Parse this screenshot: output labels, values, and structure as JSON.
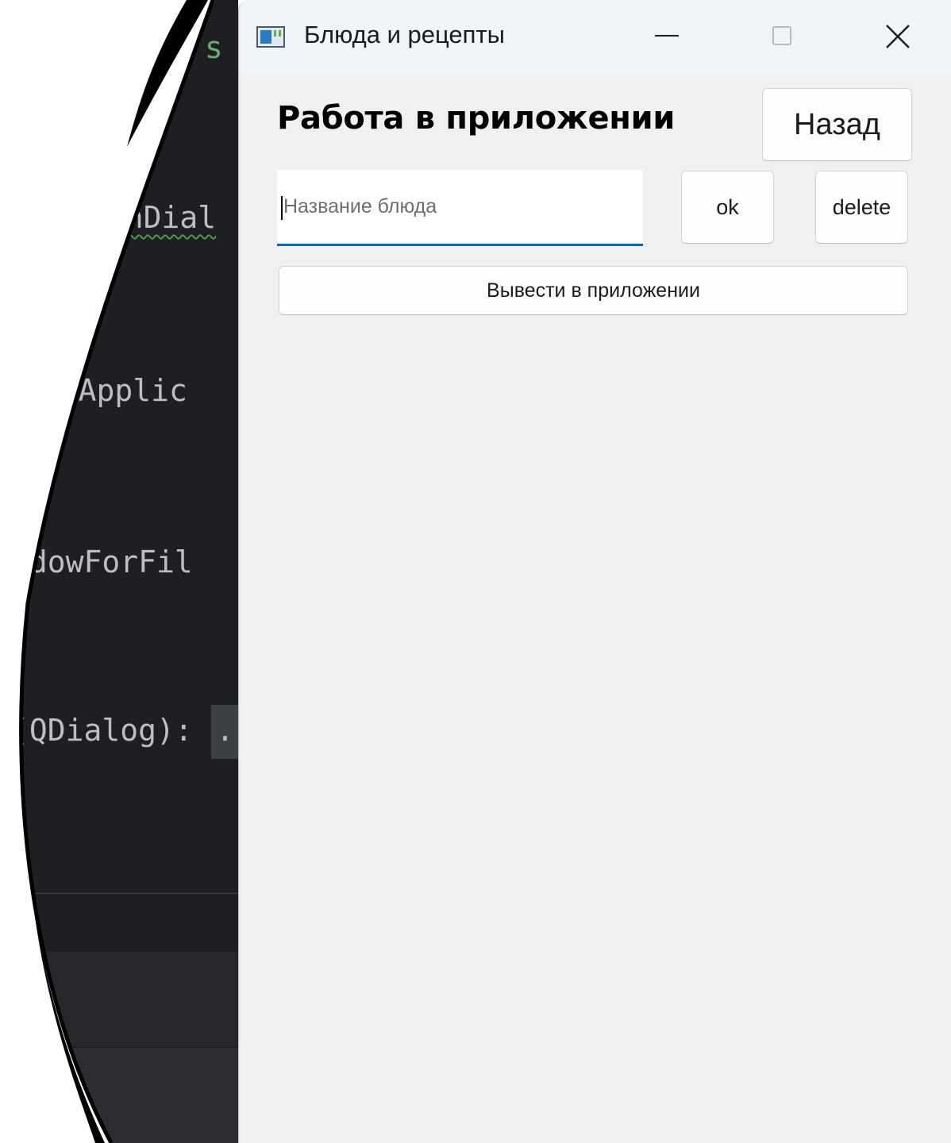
{
  "editor": {
    "lines": [
      "\"s",
      "ionDial",
      "dowApplic",
      "ndowForFil",
      "(QDialog):",
      "",
      "."
    ],
    "theme_colors": {
      "background": "#1e1f22",
      "text": "#bcbec4",
      "string": "#6aab73"
    }
  },
  "window": {
    "title": "Блюда и рецепты",
    "icon": "app-window-icon",
    "controls": {
      "minimize_icon": "minimize-icon",
      "maximize_icon": "maximize-icon",
      "close_icon": "close-icon"
    }
  },
  "content": {
    "heading": "Работа в приложении",
    "back_label": "Назад",
    "dish_name": {
      "value": "",
      "placeholder": "Название блюда"
    },
    "ok_label": "ok",
    "delete_label": "delete",
    "show_in_app_label": "Вывести в приложении"
  },
  "colors": {
    "window_background": "#f0f0f0",
    "titlebar_background": "#eff4f9",
    "accent": "#0067c0"
  }
}
